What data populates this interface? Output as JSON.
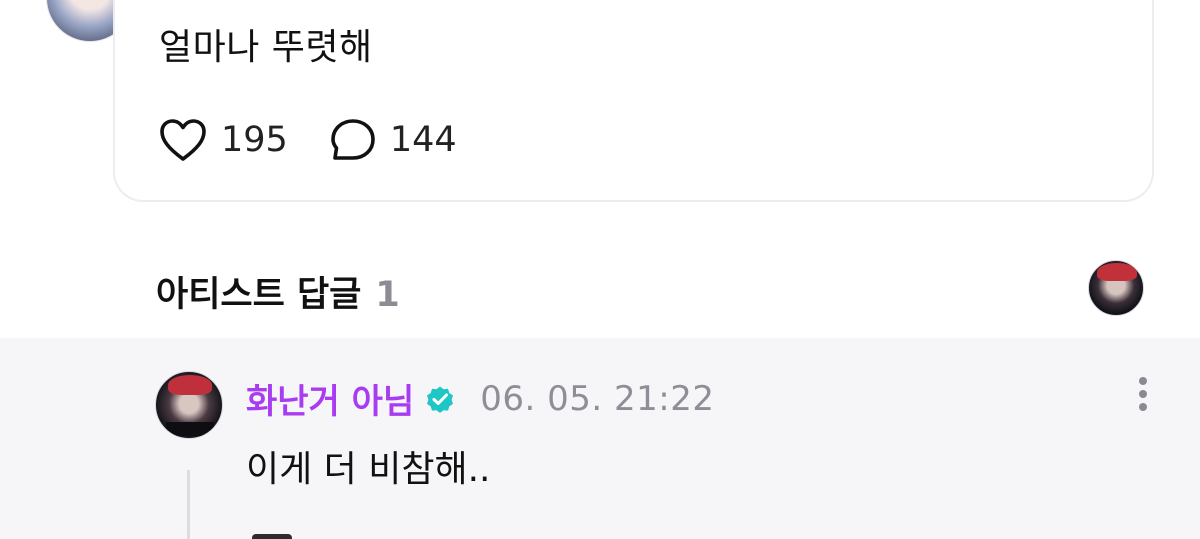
{
  "post": {
    "text": "얼마나 뚜렷해",
    "likes": "195",
    "comments": "144"
  },
  "artist_replies": {
    "title": "아티스트 답글",
    "count": "1"
  },
  "reply": {
    "author": "화난거 아님",
    "timestamp": "06. 05. 21:22",
    "text": "이게 더 비참해..",
    "verified": true
  },
  "icons": {
    "like": "heart-icon",
    "comment": "comment-bubble-icon",
    "verified": "verified-badge-icon",
    "more": "more-vertical-icon"
  },
  "colors": {
    "author": "#a93cf0",
    "verified": "#1fc6c6",
    "reply_bg": "#f6f6f9",
    "muted": "#8e8e96"
  }
}
